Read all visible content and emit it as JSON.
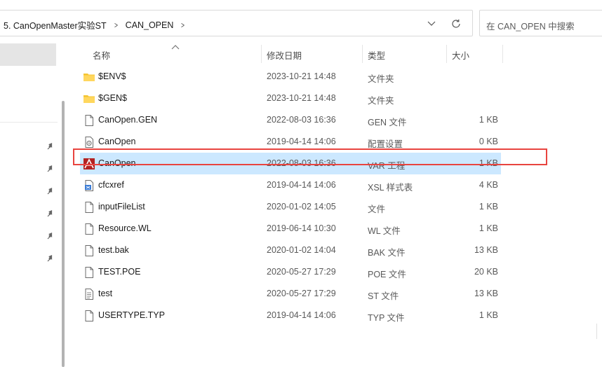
{
  "address": {
    "crumbs": [
      "5. CanOpenMaster实验ST",
      "CAN_OPEN"
    ],
    "search_placeholder": "在 CAN_OPEN 中搜索"
  },
  "columns": {
    "name": "名称",
    "date": "修改日期",
    "type": "类型",
    "size": "大小"
  },
  "files": [
    {
      "name": "$ENV$",
      "date": "2023-10-21 14:48",
      "type": "文件夹",
      "size": "",
      "icon": "folder-icon"
    },
    {
      "name": "$GEN$",
      "date": "2023-10-21 14:48",
      "type": "文件夹",
      "size": "",
      "icon": "folder-icon"
    },
    {
      "name": "CanOpen.GEN",
      "date": "2022-08-03 16:36",
      "type": "GEN 文件",
      "size": "1 KB",
      "icon": "file-icon"
    },
    {
      "name": "CanOpen",
      "date": "2019-04-14 14:06",
      "type": "配置设置",
      "size": "0 KB",
      "icon": "config-file-icon"
    },
    {
      "name": "CanOpen",
      "date": "2022-08-03 16:36",
      "type": "VAR 工程",
      "size": "1 KB",
      "icon": "var-project-icon"
    },
    {
      "name": "cfcxref",
      "date": "2019-04-14 14:06",
      "type": "XSL 样式表",
      "size": "4 KB",
      "icon": "xsl-file-icon"
    },
    {
      "name": "inputFileList",
      "date": "2020-01-02 14:05",
      "type": "文件",
      "size": "1 KB",
      "icon": "file-icon"
    },
    {
      "name": "Resource.WL",
      "date": "2019-06-14 10:30",
      "type": "WL 文件",
      "size": "1 KB",
      "icon": "file-icon"
    },
    {
      "name": "test.bak",
      "date": "2020-01-02 14:04",
      "type": "BAK 文件",
      "size": "13 KB",
      "icon": "file-icon"
    },
    {
      "name": "TEST.POE",
      "date": "2020-05-27 17:29",
      "type": "POE 文件",
      "size": "20 KB",
      "icon": "file-icon"
    },
    {
      "name": "test",
      "date": "2020-05-27 17:29",
      "type": "ST 文件",
      "size": "13 KB",
      "icon": "text-file-icon"
    },
    {
      "name": "USERTYPE.TYP",
      "date": "2019-04-14 14:06",
      "type": "TYP 文件",
      "size": "1 KB",
      "icon": "file-icon"
    }
  ],
  "selected_row": 4
}
